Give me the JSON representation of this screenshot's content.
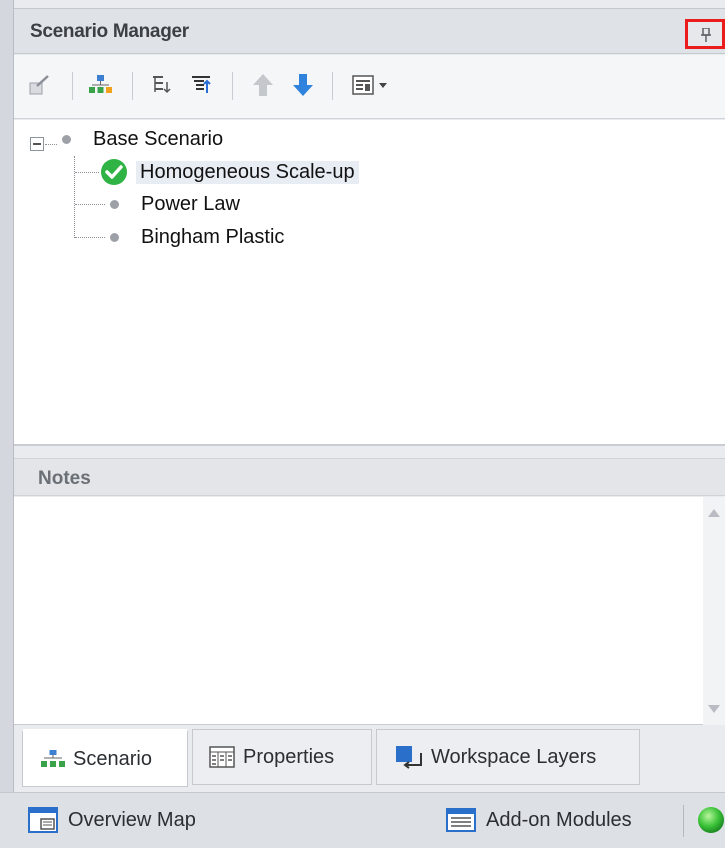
{
  "panel": {
    "title": "Scenario Manager",
    "pin_icon": "pin-icon",
    "accent_highlight": "#ea1c1c"
  },
  "toolbar": {
    "buttons": [
      {
        "name": "edit-scenario-icon"
      },
      {
        "name": "new-child-scenario-icon"
      },
      {
        "name": "collapse-tree-icon"
      },
      {
        "name": "expand-tree-icon"
      },
      {
        "name": "move-up-icon"
      },
      {
        "name": "move-down-icon"
      },
      {
        "name": "view-options-dropdown-icon"
      }
    ]
  },
  "tree": {
    "root": {
      "label": "Base Scenario",
      "expanded": true
    },
    "children": [
      {
        "label": "Homogeneous Scale-up",
        "status": "active",
        "status_color": "#2fb344"
      },
      {
        "label": "Power Law"
      },
      {
        "label": "Bingham Plastic"
      }
    ]
  },
  "notes": {
    "title": "Notes",
    "content": ""
  },
  "tabs": [
    {
      "label": "Scenario",
      "icon": "scenario-tree-icon",
      "active": true
    },
    {
      "label": "Properties",
      "icon": "properties-grid-icon",
      "active": false
    },
    {
      "label": "Workspace Layers",
      "icon": "workspace-layers-icon",
      "active": false
    }
  ],
  "bottom_bar": {
    "overview_map": {
      "label": "Overview Map",
      "icon": "overview-map-icon"
    },
    "add_on_modules": {
      "label": "Add-on Modules",
      "icon": "modules-list-icon"
    },
    "status_indicator": {
      "icon": "green-status-icon",
      "color": "#3cc43a"
    }
  }
}
